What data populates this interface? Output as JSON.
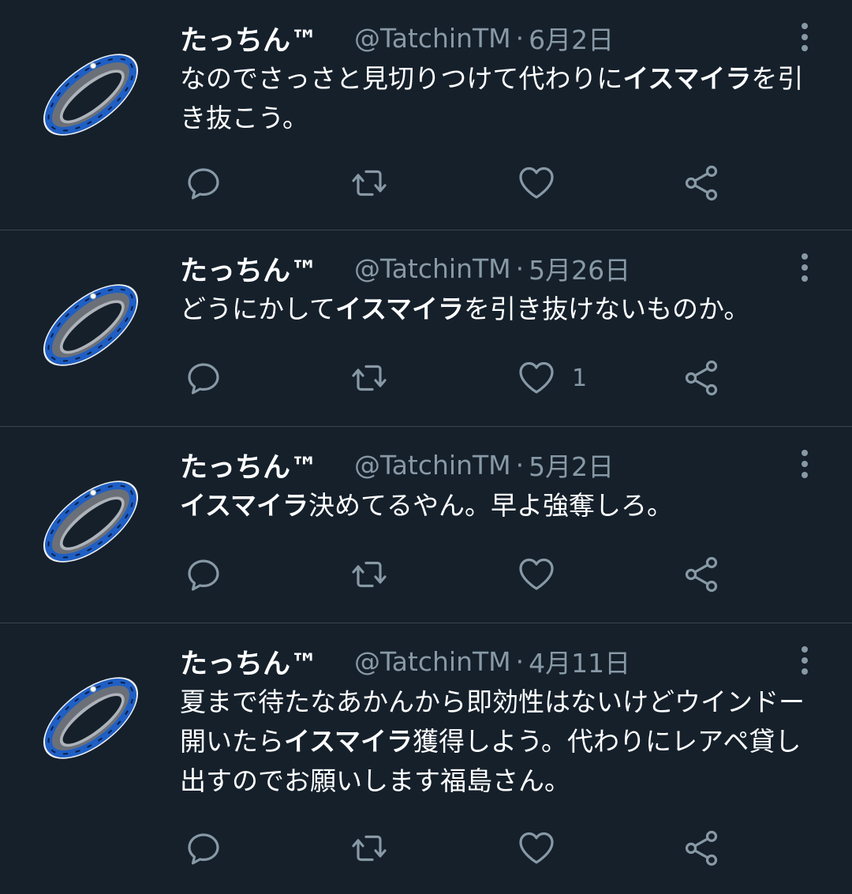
{
  "tweets": [
    {
      "name": "たっちん™",
      "handle": "@TatchinTM",
      "separator": "·",
      "date": "6月2日",
      "text": [
        {
          "t": "なのでさっさと見切りつけて代わりに",
          "b": false
        },
        {
          "t": "イスマイラ",
          "b": true
        },
        {
          "t": "を引き抜こう。",
          "b": false
        }
      ],
      "reply_count": "",
      "retweet_count": "",
      "like_count": ""
    },
    {
      "name": "たっちん™",
      "handle": "@TatchinTM",
      "separator": "·",
      "date": "5月26日",
      "text": [
        {
          "t": "どうにかして",
          "b": false
        },
        {
          "t": "イスマイラ",
          "b": true
        },
        {
          "t": "を引き抜けないものか。",
          "b": false
        }
      ],
      "reply_count": "",
      "retweet_count": "",
      "like_count": "1"
    },
    {
      "name": "たっちん™",
      "handle": "@TatchinTM",
      "separator": "·",
      "date": "5月2日",
      "text": [
        {
          "t": "イスマイラ",
          "b": true
        },
        {
          "t": "決めてるやん。早よ強奪しろ。",
          "b": false
        }
      ],
      "reply_count": "",
      "retweet_count": "",
      "like_count": ""
    },
    {
      "name": "たっちん™",
      "handle": "@TatchinTM",
      "separator": "·",
      "date": "4月11日",
      "text": [
        {
          "t": "夏まで待たなあかんから即効性はないけどウインドー開いたら",
          "b": false
        },
        {
          "t": "イスマイラ",
          "b": true
        },
        {
          "t": "獲得しよう。代わりにレアペ貸し出すのでお願いします福島さん。",
          "b": false
        }
      ],
      "reply_count": "",
      "retweet_count": "",
      "like_count": ""
    }
  ],
  "icons": {
    "avatar": "ring-avatar-icon",
    "more": "more-vertical-icon",
    "reply": "reply-icon",
    "retweet": "retweet-icon",
    "like": "heart-icon",
    "share": "share-icon"
  },
  "colors": {
    "background": "#15202b",
    "divider": "#38444d",
    "text_primary": "#ffffff",
    "text_secondary": "#8899a6",
    "ring_blue": "#1f5fc4"
  }
}
